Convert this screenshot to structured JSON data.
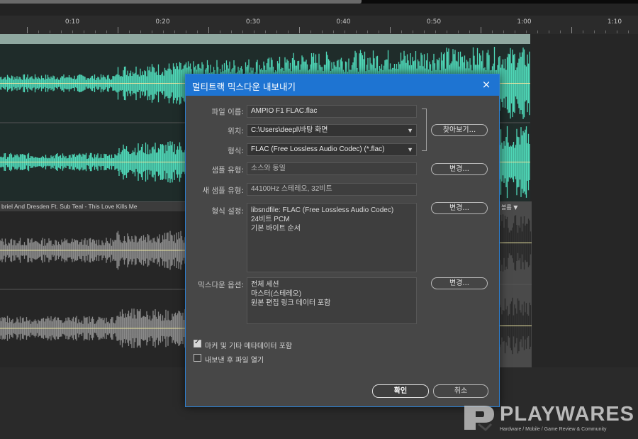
{
  "timeline": {
    "labels": [
      "0:10",
      "0:20",
      "0:30",
      "0:40",
      "0:50",
      "1:00",
      "1:10"
    ]
  },
  "tracks": {
    "clip2_title": "briel And Dresden Ft. Sub Teal - This Love Kills Me",
    "clip2_tag": "볼륨 ▼"
  },
  "colors": {
    "accent": "#1e74d2",
    "track1_wave": "#4fd8b8",
    "track2_wave": "#8a8a8a"
  },
  "dialog": {
    "title": "멀티트랙 믹스다운 내보내기",
    "close_icon": "×",
    "file_name_label": "파일 이름:",
    "file_name_value": "AMPIO F1 FLAC.flac",
    "location_label": "위치:",
    "location_value": "C:\\Users\\deepl\\바탕 화면",
    "format_label": "형식:",
    "format_value": "FLAC (Free Lossless Audio Codec) (*.flac)",
    "browse_button": "찾아보기...",
    "sample_type_label": "샘플 유형:",
    "sample_type_value": "소스와 동일",
    "change_button_1": "변경...",
    "new_sample_type_label": "새 샘플 유형:",
    "new_sample_type_value": "44100Hz 스테레오, 32비트",
    "format_settings_label": "형식 설정:",
    "format_settings_lines": [
      "libsndfile: FLAC (Free Lossless Audio Codec)",
      "24비트 PCM",
      "기본 바이트 순서"
    ],
    "change_button_2": "변경...",
    "mixdown_options_label": "믹스다운 옵션:",
    "mixdown_options_lines": [
      "전체 세션",
      "마스터(스테레오)",
      "원본 편집 링크 데이터 포함"
    ],
    "change_button_3": "변경...",
    "include_markers_label": "마커 및 기타 메타데이터 포함",
    "include_markers_checked": true,
    "open_after_export_label": "내보낸 후 파일 열기",
    "open_after_export_checked": false,
    "ok_button": "확인",
    "cancel_button": "취소"
  },
  "watermark": {
    "brand": "PLAYWARES",
    "tagline": "Hardware / Mobile / Game Review & Community"
  }
}
